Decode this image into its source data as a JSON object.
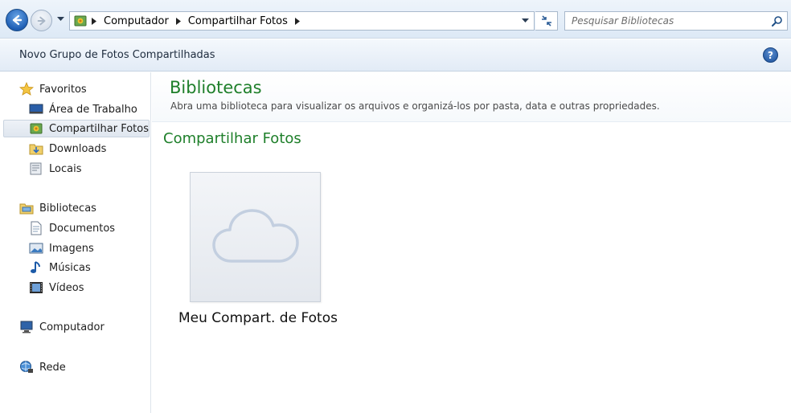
{
  "address_bar": {
    "breadcrumbs": [
      "Computador",
      "Compartilhar Fotos"
    ],
    "search_placeholder": "Pesquisar Bibliotecas"
  },
  "toolbar": {
    "new_group_label": "Novo Grupo de Fotos Compartilhadas",
    "help_label": "?"
  },
  "sidebar": {
    "favorites_label": "Favoritos",
    "favorites": [
      "Área de Trabalho",
      "Compartilhar Fotos",
      "Downloads",
      "Locais"
    ],
    "libraries_label": "Bibliotecas",
    "libraries": [
      "Documentos",
      "Imagens",
      "Músicas",
      "Vídeos"
    ],
    "computer_label": "Computador",
    "network_label": "Rede"
  },
  "main": {
    "title": "Bibliotecas",
    "description": "Abra uma biblioteca para visualizar os arquivos e organizá-los por pasta, data e outras propriedades.",
    "group_title": "Compartilhar Fotos",
    "items": [
      {
        "label": "Meu Compart. de Fotos",
        "icon": "cloud-icon"
      }
    ]
  },
  "colors": {
    "heading_green": "#1e7f2a",
    "selection_bg": "#e3e9f1"
  }
}
